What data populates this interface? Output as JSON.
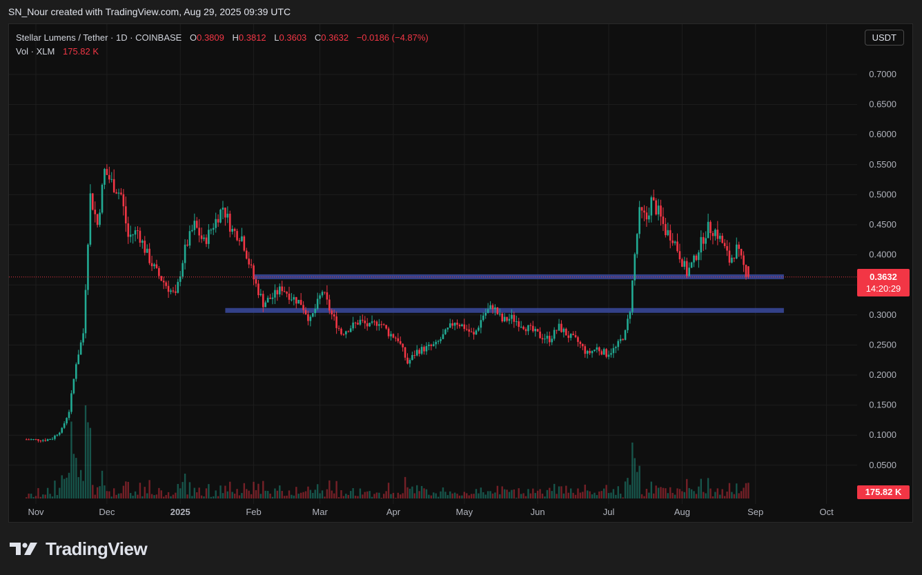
{
  "header": {
    "caption": "SN_Nour created with TradingView.com, Aug 29, 2025 09:39 UTC"
  },
  "legend": {
    "symbol": "Stellar Lumens / Tether · 1D · COINBASE",
    "o_label": "O",
    "o_value": "0.3809",
    "h_label": "H",
    "h_value": "0.3812",
    "l_label": "L",
    "l_value": "0.3603",
    "c_label": "C",
    "c_value": "0.3632",
    "change": "−0.0186 (−4.87%)",
    "vol_label": "Vol · XLM",
    "vol_value": "175.82 K"
  },
  "currency_button": "USDT",
  "price_badge": {
    "price": "0.3632",
    "countdown": "14:20:29"
  },
  "volume_badge": "175.82 K",
  "brand": {
    "name": "TradingView"
  },
  "colors": {
    "up": "#22ab94",
    "down": "#f23645",
    "zone": "#3a4a9f",
    "grid": "#1e1e1e",
    "axis_text": "#b2b5be"
  },
  "chart_data": {
    "type": "candlestick",
    "y_ticks": [
      "0.7000",
      "0.6500",
      "0.6000",
      "0.5500",
      "0.5000",
      "0.4500",
      "0.4000",
      "0.3000",
      "0.2500",
      "0.2000",
      "0.1500",
      "0.1000",
      "0.0500"
    ],
    "x_ticks": [
      "Nov",
      "Dec",
      "2025",
      "Feb",
      "Mar",
      "Apr",
      "May",
      "Jun",
      "Jul",
      "Aug",
      "Sep",
      "Oct"
    ],
    "ylim": [
      0.03,
      0.74
    ],
    "last_price": 0.3632,
    "support_zones": [
      {
        "level": 0.3635,
        "from": "2025-02-01",
        "to": "2025-09-13"
      },
      {
        "level": 0.3075,
        "from": "2025-01-20",
        "to": "2025-09-13"
      }
    ],
    "price_path": [
      [
        "2024-10-28",
        0.093
      ],
      [
        "2024-11-05",
        0.092
      ],
      [
        "2024-11-08",
        0.095
      ],
      [
        "2024-11-12",
        0.11
      ],
      [
        "2024-11-15",
        0.14
      ],
      [
        "2024-11-18",
        0.22
      ],
      [
        "2024-11-21",
        0.27
      ],
      [
        "2024-11-24",
        0.5
      ],
      [
        "2024-11-27",
        0.45
      ],
      [
        "2024-11-30",
        0.54
      ],
      [
        "2024-12-03",
        0.52
      ],
      [
        "2024-12-07",
        0.5
      ],
      [
        "2024-12-10",
        0.43
      ],
      [
        "2024-12-14",
        0.44
      ],
      [
        "2024-12-18",
        0.4
      ],
      [
        "2024-12-22",
        0.37
      ],
      [
        "2024-12-26",
        0.35
      ],
      [
        "2024-12-30",
        0.33
      ],
      [
        "2025-01-03",
        0.41
      ],
      [
        "2025-01-07",
        0.45
      ],
      [
        "2025-01-11",
        0.42
      ],
      [
        "2025-01-15",
        0.45
      ],
      [
        "2025-01-19",
        0.48
      ],
      [
        "2025-01-23",
        0.44
      ],
      [
        "2025-01-27",
        0.43
      ],
      [
        "2025-02-01",
        0.36
      ],
      [
        "2025-02-05",
        0.32
      ],
      [
        "2025-02-09",
        0.33
      ],
      [
        "2025-02-13",
        0.345
      ],
      [
        "2025-02-17",
        0.33
      ],
      [
        "2025-02-21",
        0.32
      ],
      [
        "2025-02-25",
        0.29
      ],
      [
        "2025-03-02",
        0.34
      ],
      [
        "2025-03-06",
        0.3
      ],
      [
        "2025-03-10",
        0.27
      ],
      [
        "2025-03-14",
        0.28
      ],
      [
        "2025-03-18",
        0.29
      ],
      [
        "2025-03-22",
        0.28
      ],
      [
        "2025-03-26",
        0.29
      ],
      [
        "2025-03-30",
        0.27
      ],
      [
        "2025-04-03",
        0.26
      ],
      [
        "2025-04-07",
        0.22
      ],
      [
        "2025-04-11",
        0.24
      ],
      [
        "2025-04-15",
        0.245
      ],
      [
        "2025-04-19",
        0.25
      ],
      [
        "2025-04-23",
        0.27
      ],
      [
        "2025-04-27",
        0.29
      ],
      [
        "2025-05-01",
        0.28
      ],
      [
        "2025-05-05",
        0.265
      ],
      [
        "2025-05-09",
        0.3
      ],
      [
        "2025-05-13",
        0.315
      ],
      [
        "2025-05-17",
        0.29
      ],
      [
        "2025-05-21",
        0.295
      ],
      [
        "2025-05-25",
        0.285
      ],
      [
        "2025-05-29",
        0.275
      ],
      [
        "2025-06-02",
        0.265
      ],
      [
        "2025-06-06",
        0.26
      ],
      [
        "2025-06-10",
        0.28
      ],
      [
        "2025-06-14",
        0.265
      ],
      [
        "2025-06-18",
        0.255
      ],
      [
        "2025-06-22",
        0.235
      ],
      [
        "2025-06-26",
        0.245
      ],
      [
        "2025-06-30",
        0.235
      ],
      [
        "2025-07-04",
        0.245
      ],
      [
        "2025-07-08",
        0.27
      ],
      [
        "2025-07-10",
        0.31
      ],
      [
        "2025-07-12",
        0.4
      ],
      [
        "2025-07-14",
        0.47
      ],
      [
        "2025-07-17",
        0.46
      ],
      [
        "2025-07-19",
        0.49
      ],
      [
        "2025-07-22",
        0.47
      ],
      [
        "2025-07-25",
        0.44
      ],
      [
        "2025-07-28",
        0.43
      ],
      [
        "2025-07-31",
        0.4
      ],
      [
        "2025-08-03",
        0.37
      ],
      [
        "2025-08-06",
        0.39
      ],
      [
        "2025-08-09",
        0.42
      ],
      [
        "2025-08-12",
        0.445
      ],
      [
        "2025-08-15",
        0.44
      ],
      [
        "2025-08-18",
        0.42
      ],
      [
        "2025-08-21",
        0.39
      ],
      [
        "2025-08-24",
        0.41
      ],
      [
        "2025-08-27",
        0.38
      ],
      [
        "2025-08-29",
        0.3632
      ]
    ]
  }
}
